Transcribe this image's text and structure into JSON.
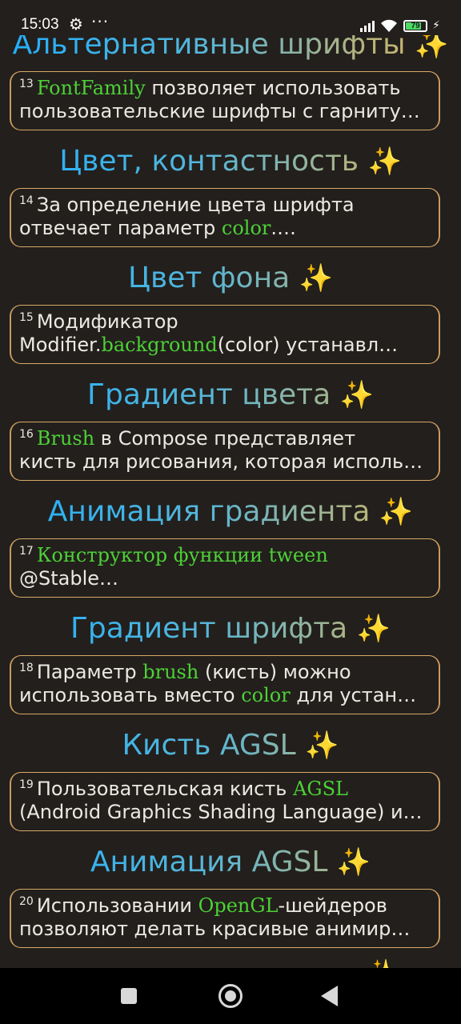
{
  "status_bar": {
    "time": "15:03",
    "gear_icon": "gear-icon",
    "more": "···",
    "battery_percent": "79",
    "battery_level": 0.79,
    "icons": [
      "signal-icon",
      "wifi-icon",
      "battery-icon",
      "charging-icon"
    ]
  },
  "colors": {
    "background": "#231f1c",
    "keyword": "#4cd137",
    "border": "#d8a86a",
    "title_gradient_start": "#1fb0ff",
    "title_gradient_end": "#d6b66a",
    "sparkle": "#f4c542"
  },
  "sparkle": "✨",
  "sections": [
    {
      "title": "Альтернативные шрифты",
      "num": "13",
      "l1_kw": "FontFamily",
      "l1_after": " позволяет использовать",
      "l2_text": "пользовательские шрифты с гарниту…"
    },
    {
      "title": "Цвет, контастность",
      "num": "14",
      "l1_text": "За определение цвета шрифта",
      "l2_before": "отвечает параметр ",
      "l2_kw": "color",
      "l2_after": ".…"
    },
    {
      "title": "Цвет фона ",
      "num": "15",
      "l1_text": "Модификатор",
      "l2_before": "Modifier.",
      "l2_kw": "background",
      "l2_after": "(color) устанавл…"
    },
    {
      "title": "Градиент цвета",
      "num": "16",
      "l1_kw": "Brush",
      "l1_after": " в Compose представляет",
      "l2_text": "кисть для рисования, которая исполь…"
    },
    {
      "title": "Анимация градиента",
      "num": "17",
      "l1_kw": "Конструктор функции tween",
      "l2_text": "@Stable…"
    },
    {
      "title": "Градиент шрифта",
      "num": "18",
      "l1_before": "Параметр ",
      "l1_kw": "brush",
      "l1_after": " (кисть) можно",
      "l2_before": "использовать вместо ",
      "l2_kw": "color",
      "l2_after": " для устан…"
    },
    {
      "title": "Кисть AGSL",
      "num": "19",
      "l1_before": "Пользовательская кисть ",
      "l1_kw": "AGSL",
      "l2_text": "(Android Graphics Shading Language) и…"
    },
    {
      "title": "Анимация AGSL",
      "num": "20",
      "l1_before": "Использовании ",
      "l1_kw": "OpenGL",
      "l1_after": "-шейдеров",
      "l2_text": "позволяют делать красивые анимир…"
    }
  ],
  "nav": {
    "recents": "recents-square-icon",
    "home": "home-circle-icon",
    "back": "back-triangle-icon"
  }
}
